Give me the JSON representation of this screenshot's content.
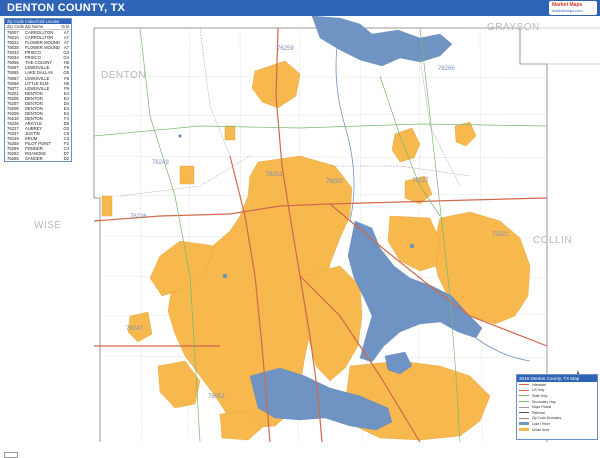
{
  "header": {
    "title": "DENTON COUNTY, TX"
  },
  "logo": {
    "brand": "Market Maps",
    "sub": "marketmaps.com"
  },
  "map": {
    "county_labels": [
      "GRAYSON",
      "DENTON",
      "WISE",
      "COLLIN"
    ],
    "zip_labels": [
      "76259",
      "76266",
      "76227",
      "76249",
      "76200",
      "76226",
      "76247",
      "76201",
      "76052",
      "75022"
    ],
    "colors": {
      "urban": "#f7b84e",
      "water": "#6f93c3",
      "highway": "#d06a4c",
      "road": "#78b86e",
      "boundary": "#888888",
      "header": "#2f63b6"
    }
  },
  "zip_table": {
    "title": "Zip Code Index/Grid Locator",
    "headers": [
      "Zip Code",
      "Zip Name",
      "Grid"
    ],
    "rows": [
      [
        "75007",
        "CARROLLTON",
        "A7"
      ],
      [
        "75010",
        "CARROLLTON",
        "A7"
      ],
      [
        "75022",
        "FLOWER MOUND",
        "A7"
      ],
      [
        "75028",
        "FLOWER MOUND",
        "A7"
      ],
      [
        "75033",
        "FRISCO",
        "G3"
      ],
      [
        "75034",
        "FRISCO",
        "G4"
      ],
      [
        "75056",
        "THE COLONY",
        "H6"
      ],
      [
        "75057",
        "LEWISVILLE",
        "F6"
      ],
      [
        "75065",
        "LAKE DALLAS",
        "G5"
      ],
      [
        "75067",
        "LEWISVILLE",
        "F6"
      ],
      [
        "75068",
        "LITTLE ELM",
        "H5"
      ],
      [
        "75077",
        "LEWISVILLE",
        "F6"
      ],
      [
        "76201",
        "DENTON",
        "E4"
      ],
      [
        "76205",
        "DENTON",
        "E4"
      ],
      [
        "76207",
        "DENTON",
        "D4"
      ],
      [
        "76208",
        "DENTON",
        "E4"
      ],
      [
        "76209",
        "DENTON",
        "E4"
      ],
      [
        "76210",
        "DENTON",
        "F4"
      ],
      [
        "76226",
        "ARGYLE",
        "D5"
      ],
      [
        "76227",
        "AUBREY",
        "G3"
      ],
      [
        "76247",
        "JUSTIN",
        "C5"
      ],
      [
        "76249",
        "KRUM",
        "C3"
      ],
      [
        "76258",
        "PILOT POINT",
        "F2"
      ],
      [
        "76259",
        "PONDER",
        "C4"
      ],
      [
        "76262",
        "ROANOKE",
        "D7"
      ],
      [
        "76266",
        "SANGER",
        "D2"
      ]
    ]
  },
  "legend": {
    "title": "2016 Denton County, TX Map",
    "items": [
      {
        "label": "Interstate",
        "color": "#d06a4c"
      },
      {
        "label": "US Hwy",
        "color": "#d06a4c"
      },
      {
        "label": "State Hwy",
        "color": "#78b86e"
      },
      {
        "label": "Secondary Hwy",
        "color": "#78b86e"
      },
      {
        "label": "Major Roads",
        "color": "#9a9a9a"
      },
      {
        "label": "Railroad",
        "color": "#555555"
      },
      {
        "label": "Zip Code Boundary",
        "color": "#888888"
      },
      {
        "label": "Lake / River",
        "color": "#6f93c3"
      },
      {
        "label": "Urban Area",
        "color": "#f7b84e"
      }
    ]
  }
}
